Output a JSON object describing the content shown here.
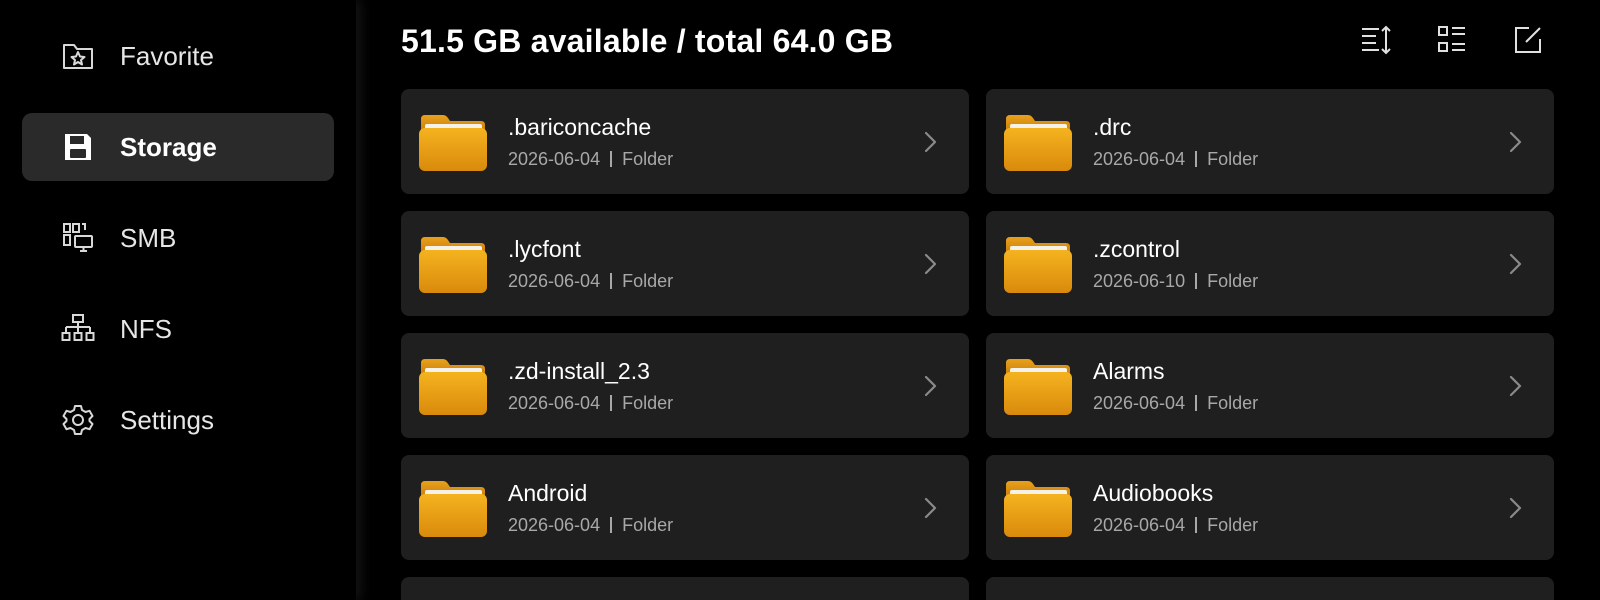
{
  "sidebar": {
    "items": [
      {
        "label": "Favorite",
        "icon": "star-folder-icon",
        "active": false
      },
      {
        "label": "Storage",
        "icon": "save-disk-icon",
        "active": true
      },
      {
        "label": "SMB",
        "icon": "network-share-icon",
        "active": false
      },
      {
        "label": "NFS",
        "icon": "network-tree-icon",
        "active": false
      },
      {
        "label": "Settings",
        "icon": "gear-icon",
        "active": false
      }
    ]
  },
  "header": {
    "title": "51.5 GB available / total 64.0 GB",
    "tools": [
      "sort-icon",
      "view-list-icon",
      "edit-icon"
    ]
  },
  "files": [
    {
      "name": ".bariconcache",
      "date": "2026-06-04",
      "type": "Folder"
    },
    {
      "name": ".drc",
      "date": "2026-06-04",
      "type": "Folder"
    },
    {
      "name": ".lycfont",
      "date": "2026-06-04",
      "type": "Folder"
    },
    {
      "name": ".zcontrol",
      "date": "2026-06-10",
      "type": "Folder"
    },
    {
      "name": ".zd-install_2.3",
      "date": "2026-06-04",
      "type": "Folder"
    },
    {
      "name": "Alarms",
      "date": "2026-06-04",
      "type": "Folder"
    },
    {
      "name": "Android",
      "date": "2026-06-04",
      "type": "Folder"
    },
    {
      "name": "Audiobooks",
      "date": "2026-06-04",
      "type": "Folder"
    }
  ],
  "colors": {
    "accent_folder": "#f0a21a",
    "card_bg": "#1f1f1f",
    "active_bg": "#2a2a2a"
  }
}
